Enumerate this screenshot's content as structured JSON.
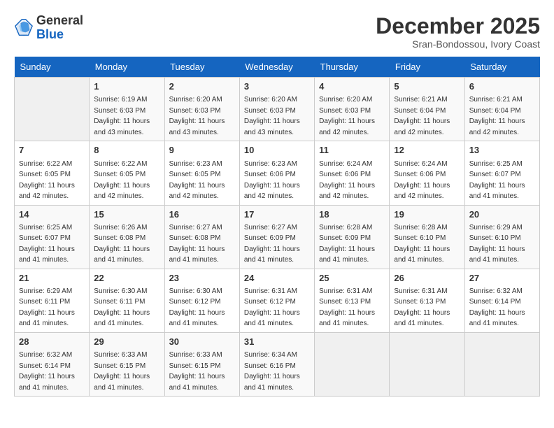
{
  "header": {
    "logo_general": "General",
    "logo_blue": "Blue",
    "month_year": "December 2025",
    "location": "Sran-Bondossou, Ivory Coast"
  },
  "days_of_week": [
    "Sunday",
    "Monday",
    "Tuesday",
    "Wednesday",
    "Thursday",
    "Friday",
    "Saturday"
  ],
  "weeks": [
    [
      {
        "day": "",
        "info": ""
      },
      {
        "day": "1",
        "info": "Sunrise: 6:19 AM\nSunset: 6:03 PM\nDaylight: 11 hours\nand 43 minutes."
      },
      {
        "day": "2",
        "info": "Sunrise: 6:20 AM\nSunset: 6:03 PM\nDaylight: 11 hours\nand 43 minutes."
      },
      {
        "day": "3",
        "info": "Sunrise: 6:20 AM\nSunset: 6:03 PM\nDaylight: 11 hours\nand 43 minutes."
      },
      {
        "day": "4",
        "info": "Sunrise: 6:20 AM\nSunset: 6:03 PM\nDaylight: 11 hours\nand 42 minutes."
      },
      {
        "day": "5",
        "info": "Sunrise: 6:21 AM\nSunset: 6:04 PM\nDaylight: 11 hours\nand 42 minutes."
      },
      {
        "day": "6",
        "info": "Sunrise: 6:21 AM\nSunset: 6:04 PM\nDaylight: 11 hours\nand 42 minutes."
      }
    ],
    [
      {
        "day": "7",
        "info": "Sunrise: 6:22 AM\nSunset: 6:05 PM\nDaylight: 11 hours\nand 42 minutes."
      },
      {
        "day": "8",
        "info": "Sunrise: 6:22 AM\nSunset: 6:05 PM\nDaylight: 11 hours\nand 42 minutes."
      },
      {
        "day": "9",
        "info": "Sunrise: 6:23 AM\nSunset: 6:05 PM\nDaylight: 11 hours\nand 42 minutes."
      },
      {
        "day": "10",
        "info": "Sunrise: 6:23 AM\nSunset: 6:06 PM\nDaylight: 11 hours\nand 42 minutes."
      },
      {
        "day": "11",
        "info": "Sunrise: 6:24 AM\nSunset: 6:06 PM\nDaylight: 11 hours\nand 42 minutes."
      },
      {
        "day": "12",
        "info": "Sunrise: 6:24 AM\nSunset: 6:06 PM\nDaylight: 11 hours\nand 42 minutes."
      },
      {
        "day": "13",
        "info": "Sunrise: 6:25 AM\nSunset: 6:07 PM\nDaylight: 11 hours\nand 41 minutes."
      }
    ],
    [
      {
        "day": "14",
        "info": "Sunrise: 6:25 AM\nSunset: 6:07 PM\nDaylight: 11 hours\nand 41 minutes."
      },
      {
        "day": "15",
        "info": "Sunrise: 6:26 AM\nSunset: 6:08 PM\nDaylight: 11 hours\nand 41 minutes."
      },
      {
        "day": "16",
        "info": "Sunrise: 6:27 AM\nSunset: 6:08 PM\nDaylight: 11 hours\nand 41 minutes."
      },
      {
        "day": "17",
        "info": "Sunrise: 6:27 AM\nSunset: 6:09 PM\nDaylight: 11 hours\nand 41 minutes."
      },
      {
        "day": "18",
        "info": "Sunrise: 6:28 AM\nSunset: 6:09 PM\nDaylight: 11 hours\nand 41 minutes."
      },
      {
        "day": "19",
        "info": "Sunrise: 6:28 AM\nSunset: 6:10 PM\nDaylight: 11 hours\nand 41 minutes."
      },
      {
        "day": "20",
        "info": "Sunrise: 6:29 AM\nSunset: 6:10 PM\nDaylight: 11 hours\nand 41 minutes."
      }
    ],
    [
      {
        "day": "21",
        "info": "Sunrise: 6:29 AM\nSunset: 6:11 PM\nDaylight: 11 hours\nand 41 minutes."
      },
      {
        "day": "22",
        "info": "Sunrise: 6:30 AM\nSunset: 6:11 PM\nDaylight: 11 hours\nand 41 minutes."
      },
      {
        "day": "23",
        "info": "Sunrise: 6:30 AM\nSunset: 6:12 PM\nDaylight: 11 hours\nand 41 minutes."
      },
      {
        "day": "24",
        "info": "Sunrise: 6:31 AM\nSunset: 6:12 PM\nDaylight: 11 hours\nand 41 minutes."
      },
      {
        "day": "25",
        "info": "Sunrise: 6:31 AM\nSunset: 6:13 PM\nDaylight: 11 hours\nand 41 minutes."
      },
      {
        "day": "26",
        "info": "Sunrise: 6:31 AM\nSunset: 6:13 PM\nDaylight: 11 hours\nand 41 minutes."
      },
      {
        "day": "27",
        "info": "Sunrise: 6:32 AM\nSunset: 6:14 PM\nDaylight: 11 hours\nand 41 minutes."
      }
    ],
    [
      {
        "day": "28",
        "info": "Sunrise: 6:32 AM\nSunset: 6:14 PM\nDaylight: 11 hours\nand 41 minutes."
      },
      {
        "day": "29",
        "info": "Sunrise: 6:33 AM\nSunset: 6:15 PM\nDaylight: 11 hours\nand 41 minutes."
      },
      {
        "day": "30",
        "info": "Sunrise: 6:33 AM\nSunset: 6:15 PM\nDaylight: 11 hours\nand 41 minutes."
      },
      {
        "day": "31",
        "info": "Sunrise: 6:34 AM\nSunset: 6:16 PM\nDaylight: 11 hours\nand 41 minutes."
      },
      {
        "day": "",
        "info": ""
      },
      {
        "day": "",
        "info": ""
      },
      {
        "day": "",
        "info": ""
      }
    ]
  ]
}
